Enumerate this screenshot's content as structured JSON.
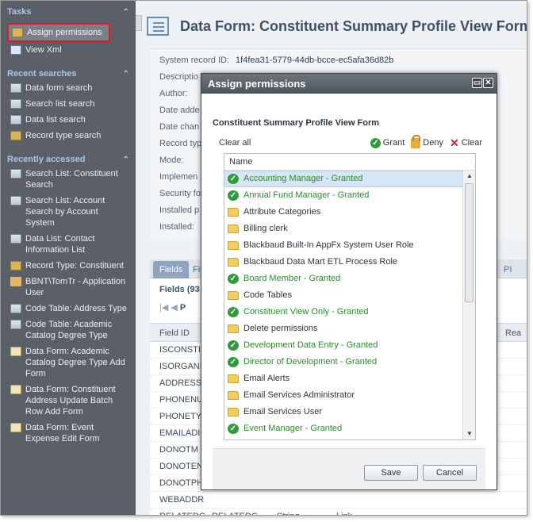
{
  "sidebar": {
    "tasks_heading": "Tasks",
    "tasks": [
      {
        "label": "Assign permissions",
        "icon": "key-icon"
      },
      {
        "label": "View Xml",
        "icon": "xml-icon"
      }
    ],
    "recent_searches_heading": "Recent searches",
    "recent_searches": [
      {
        "label": "Data form search"
      },
      {
        "label": "Search list search"
      },
      {
        "label": "Data list search"
      },
      {
        "label": "Record type search"
      }
    ],
    "recently_accessed_heading": "Recently accessed",
    "recently_accessed": [
      {
        "label": "Search List: Constituent Search",
        "icon": "grid-icon"
      },
      {
        "label": "Search List: Account Search by Account System",
        "icon": "grid-icon"
      },
      {
        "label": "Data List: Contact Information List",
        "icon": "grid-icon"
      },
      {
        "label": "Record Type: Constituent",
        "icon": "key-icon"
      },
      {
        "label": "BBNT\\TomTr - Application User",
        "icon": "user-icon"
      },
      {
        "label": "Code Table: Address Type",
        "icon": "grid-icon"
      },
      {
        "label": "Code Table: Academic Catalog Degree Type",
        "icon": "grid-icon"
      },
      {
        "label": "Data Form: Academic Catalog Degree Type Add Form",
        "icon": "doc-icon"
      },
      {
        "label": "Data Form: Constituent Address Update Batch Row Add Form",
        "icon": "doc-icon"
      },
      {
        "label": "Data Form: Event Expense Edit Form",
        "icon": "doc-icon"
      }
    ]
  },
  "header": {
    "title": "Data Form: Constituent Summary Profile View Form"
  },
  "properties": {
    "system_record_id_label": "System record ID:",
    "system_record_id": "1f4fea31-5779-44db-bcce-ec5afa36d82b",
    "labels": [
      "Descriptio",
      "Author:",
      "Date adde",
      "Date chan",
      "Record typ",
      "Mode:",
      "Implemen",
      "Security fo",
      "Installed p",
      "Installed:"
    ]
  },
  "tabs": {
    "items": [
      "Fields",
      "Fi"
    ],
    "right_label": "PI"
  },
  "grid": {
    "fields_label": "Fields (93",
    "pager_label": "P",
    "header_field_id": "Field ID",
    "header_right": "Rea",
    "rows": [
      "ISCONSTI",
      "ISORGANI",
      "ADDRESS",
      "PHONENU",
      "PHONETY",
      "EMAILADI",
      "DONOTM",
      "DONOTEN",
      "DONOTPH",
      "WEBADDR"
    ],
    "last_row": {
      "c1": "RELATEDC...",
      "c2": "RELATEDC...",
      "c3": "String",
      "c4": "Link"
    }
  },
  "modal": {
    "title": "Assign permissions",
    "form_title": "Constituent Summary Profile View Form",
    "clear_all": "Clear all",
    "grant_label": "Grant",
    "deny_label": "Deny",
    "clear_label": "Clear",
    "list_header": "Name",
    "rows": [
      {
        "label": "Accounting Manager - Granted",
        "granted": true,
        "selected": true
      },
      {
        "label": "Annual Fund Manager - Granted",
        "granted": true
      },
      {
        "label": "Attribute Categories",
        "granted": false
      },
      {
        "label": "Billing clerk",
        "granted": false
      },
      {
        "label": "Blackbaud Built-In AppFx System User Role",
        "granted": false
      },
      {
        "label": "Blackbaud Data Mart ETL Process Role",
        "granted": false
      },
      {
        "label": "Board Member - Granted",
        "granted": true
      },
      {
        "label": "Code Tables",
        "granted": false
      },
      {
        "label": "Constituent View Only - Granted",
        "granted": true
      },
      {
        "label": "Delete permissions",
        "granted": false
      },
      {
        "label": "Development Data Entry - Granted",
        "granted": true
      },
      {
        "label": "Director of Development - Granted",
        "granted": true
      },
      {
        "label": "Email Alerts",
        "granted": false
      },
      {
        "label": "Email Services Administrator",
        "granted": false
      },
      {
        "label": "Email Services User",
        "granted": false
      },
      {
        "label": "Event Manager - Granted",
        "granted": true
      }
    ],
    "save_label": "Save",
    "cancel_label": "Cancel"
  }
}
